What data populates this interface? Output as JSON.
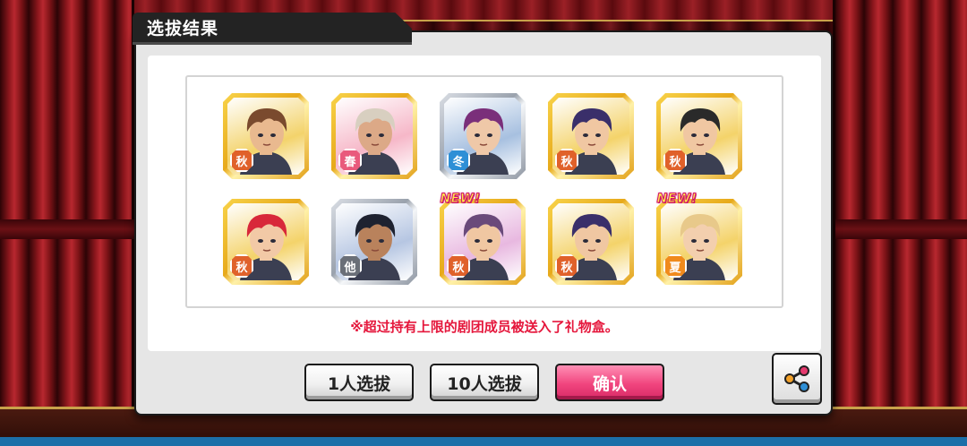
{
  "dialog": {
    "title": "选拔结果",
    "notice": "※超过持有上限的剧团成员被送入了礼物盒。"
  },
  "results": [
    {
      "season": "秋",
      "season_type": "autumn",
      "frame": "gold",
      "new": false,
      "hair": "#7a4a2e",
      "skin": "#e9b98f",
      "bg": "#f3d36b"
    },
    {
      "season": "春",
      "season_type": "spring",
      "frame": "gold",
      "new": false,
      "hair": "#d8cfc0",
      "skin": "#dca987",
      "bg": "#f6b7c8"
    },
    {
      "season": "冬",
      "season_type": "winter",
      "frame": "silver",
      "new": false,
      "hair": "#7a2f7a",
      "skin": "#efc8a8",
      "bg": "#a7c0e0"
    },
    {
      "season": "秋",
      "season_type": "autumn",
      "frame": "gold",
      "new": false,
      "hair": "#3a2f6a",
      "skin": "#f0c7a2",
      "bg": "#f4d36a"
    },
    {
      "season": "秋",
      "season_type": "autumn",
      "frame": "gold",
      "new": false,
      "hair": "#2a2a2a",
      "skin": "#f0c7a2",
      "bg": "#f4d36a"
    },
    {
      "season": "秋",
      "season_type": "autumn",
      "frame": "gold",
      "new": false,
      "hair": "#d8283a",
      "skin": "#f2c9a6",
      "bg": "#f4d36a"
    },
    {
      "season": "他",
      "season_type": "other",
      "frame": "silver",
      "new": false,
      "hair": "#1e2230",
      "skin": "#b9825c",
      "bg": "#b6c6e2"
    },
    {
      "season": "秋",
      "season_type": "autumn",
      "frame": "gold",
      "new": true,
      "hair": "#6a4a7a",
      "skin": "#f0c7a2",
      "bg": "#e8b8e0"
    },
    {
      "season": "秋",
      "season_type": "autumn",
      "frame": "gold",
      "new": false,
      "hair": "#3a2f6a",
      "skin": "#f0c7a2",
      "bg": "#f4d36a"
    },
    {
      "season": "夏",
      "season_type": "summer",
      "frame": "gold",
      "new": true,
      "hair": "#e8c98a",
      "skin": "#f3cfae",
      "bg": "#f4d36a"
    }
  ],
  "new_label": "NEW!",
  "buttons": {
    "single": "1人选拔",
    "ten": "10人选拔",
    "confirm": "确认"
  },
  "share_icon": "share-icon"
}
